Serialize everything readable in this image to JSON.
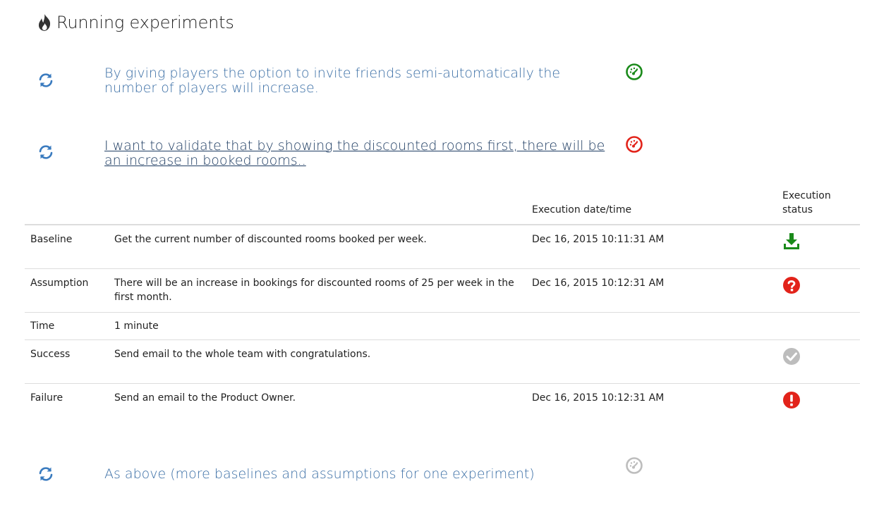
{
  "page": {
    "title": "Running experiments"
  },
  "experiments": [
    {
      "text": "By giving players the option to invite friends semi-automatically the number of players will increase.",
      "gauge_color": "#1a8a1a"
    },
    {
      "text": "I want to validate that by showing the discounted rooms first, there will be an increase in booked rooms..",
      "gauge_color": "#e2231a"
    },
    {
      "text": "As above (more baselines and assumptions for one experiment)",
      "gauge_color": "#bdbdbd"
    }
  ],
  "table": {
    "headers": {
      "type": "",
      "description": "",
      "date": "Execution date/time",
      "status": "Execution status"
    },
    "rows": [
      {
        "type": "Baseline",
        "description": "Get the current number of discounted rooms booked per week.",
        "date": "Dec 16, 2015 10:11:31 AM",
        "status_icon": "download-icon",
        "status_color": "#1a8a1a"
      },
      {
        "type": "Assumption",
        "description": "There will be an increase in bookings for discounted rooms of 25 per week in the first month.",
        "date": "Dec 16, 2015 10:12:31 AM",
        "status_icon": "question-circle-icon",
        "status_color": "#e2231a"
      },
      {
        "type": "Time",
        "description": "1 minute",
        "date": "",
        "status_icon": "",
        "status_color": ""
      },
      {
        "type": "Success",
        "description": "Send email to the whole team with congratulations.",
        "date": "",
        "status_icon": "check-circle-icon",
        "status_color": "#bdbdbd"
      },
      {
        "type": "Failure",
        "description": "Send an email to the Product Owner.",
        "date": "Dec 16, 2015 10:12:31 AM",
        "status_icon": "exclamation-circle-icon",
        "status_color": "#e2231a"
      }
    ]
  }
}
